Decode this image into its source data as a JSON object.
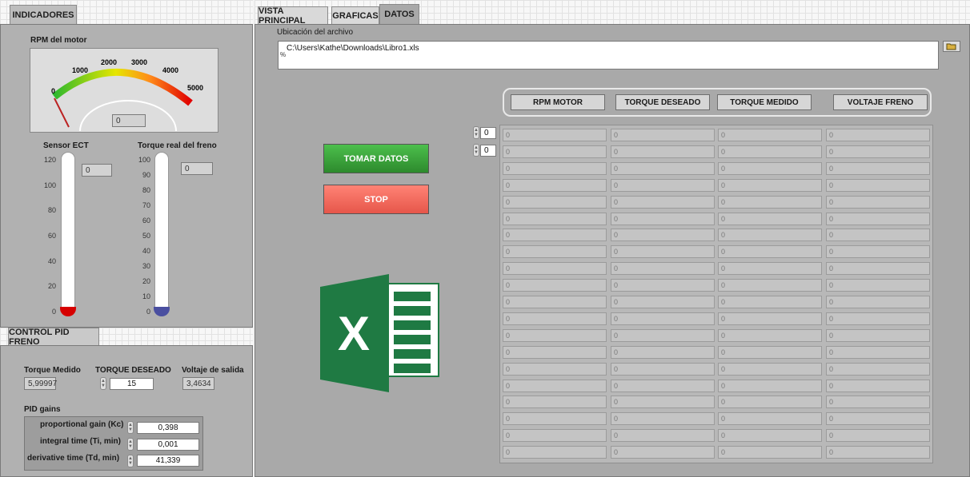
{
  "left_tab": {
    "label": "INDICADORES"
  },
  "gauge": {
    "title": "RPM del motor",
    "ticks": [
      "0",
      "1000",
      "2000",
      "3000",
      "4000",
      "5000"
    ],
    "value": "0"
  },
  "sensor_ect": {
    "title": "Sensor ECT",
    "ticks": [
      "120",
      "100",
      "80",
      "60",
      "40",
      "20",
      "0"
    ],
    "value": "0"
  },
  "torque_real": {
    "title": "Torque real del freno",
    "ticks": [
      "100",
      "90",
      "80",
      "70",
      "60",
      "50",
      "40",
      "30",
      "20",
      "10",
      "0"
    ],
    "value": "0"
  },
  "pid_tab": {
    "label": "CONTROL PID FRENO"
  },
  "pid": {
    "torque_medido_label": "Torque Medido",
    "torque_medido_value": "5,99997",
    "torque_deseado_label": "TORQUE DESEADO",
    "torque_deseado_value": "15",
    "voltaje_label": "Voltaje de salida",
    "voltaje_value": "3,4634",
    "gains_title": "PID gains",
    "kc_label": "proportional gain (Kc)",
    "kc_value": "0,398",
    "ti_label": "integral time (Ti, min)",
    "ti_value": "0,001",
    "td_label": "derivative time (Td, min)",
    "td_value": "41,339"
  },
  "top_tabs": [
    "VISTA PRINCIPAL",
    "GRAFICAS",
    "DATOS"
  ],
  "file": {
    "label": "Ubicación del archivo",
    "path": "C:\\Users\\Kathe\\Downloads\\Libro1.xls",
    "prefix": "%"
  },
  "buttons": {
    "tomar": "TOMAR DATOS",
    "stop": "STOP"
  },
  "table": {
    "headers": [
      "RPM MOTOR",
      "TORQUE DESEADO",
      "TORQUE MEDIDO",
      "VOLTAJE FRENO"
    ],
    "row_index": "0",
    "col_index": "0",
    "cell_value": "0",
    "rows": 20
  },
  "excel_logo": {
    "letter": "X"
  },
  "colors": {
    "green_button": "#3a9d3a",
    "red_button": "#f26a5c",
    "excel_green": "#1f7a43"
  }
}
